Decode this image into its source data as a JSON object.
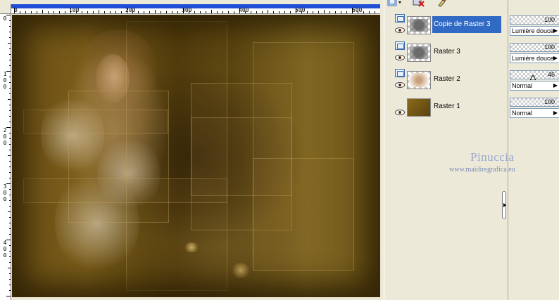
{
  "rulers": {
    "top_labels": [
      "0",
      "100",
      "200",
      "300",
      "400",
      "500",
      "600"
    ],
    "left_labels": [
      [
        "0"
      ],
      [
        "1",
        "0",
        "0"
      ],
      [
        "2",
        "0",
        "0"
      ],
      [
        "3",
        "0",
        "0"
      ],
      [
        "4",
        "0",
        "0"
      ]
    ]
  },
  "layers_panel": {
    "layers": [
      {
        "name": "Copie de Raster 3",
        "selected": true,
        "thumb": "grey-blobs"
      },
      {
        "name": "Raster 3",
        "selected": false,
        "thumb": "grey-blobs"
      },
      {
        "name": "Raster 2",
        "selected": false,
        "thumb": "flower"
      },
      {
        "name": "Raster 1",
        "selected": false,
        "thumb": "brown-fill"
      }
    ]
  },
  "properties": [
    {
      "opacity": "100",
      "blend_mode": "Lumière douce"
    },
    {
      "opacity": "100",
      "blend_mode": "Lumière douce"
    },
    {
      "opacity": "46",
      "blend_mode": "Normal"
    },
    {
      "opacity": "100",
      "blend_mode": "Normal"
    }
  ],
  "watermark": {
    "title": "Pinuccia",
    "url": "www.maidiregrafica.eu"
  },
  "colors": {
    "selection": "#316ac5",
    "panel_bg": "#ece9d8",
    "ruler_strip": "#1f4fd6",
    "canvas_base": "#6b4f15"
  }
}
